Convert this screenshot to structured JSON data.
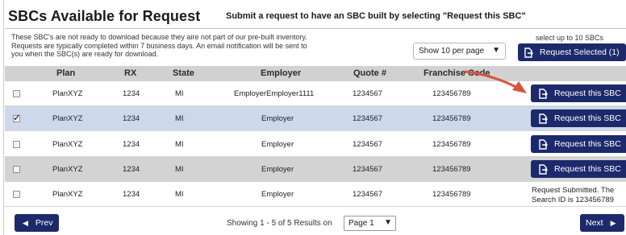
{
  "header": {
    "title": "SBCs Available for Request",
    "subtitle": "Submit a request to have an SBC built by selecting \"Request this SBC\""
  },
  "info": {
    "line1": "These SBC's are not ready to download because they aire not part of our pre-built inventory.",
    "line2": "Requests are typically completed within 7 business days. An email notification will be sent to",
    "line3": "you when the SBC(s) are ready for download."
  },
  "per_page": {
    "value": "Show 10 per page",
    "caret": "▼"
  },
  "select_hint": "select up to 10 SBCs",
  "request_selected_label": "Request Selected (1)",
  "table": {
    "headers": {
      "plan": "Plan",
      "rx": "RX",
      "state": "State",
      "employer": "Employer",
      "quote": "Quote #",
      "franchise": "Franchise Code"
    },
    "rows": [
      {
        "checked": false,
        "plan": "PlanXYZ",
        "rx": "1234",
        "state": "MI",
        "employer": "EmployerEmployer1111",
        "quote": "1234567",
        "franchise": "123456789",
        "action": "Request this SBC",
        "status_line1": "",
        "status_line2": ""
      },
      {
        "checked": true,
        "plan": "PlanXYZ",
        "rx": "1234",
        "state": "MI",
        "employer": "Employer",
        "quote": "1234567",
        "franchise": "123456789",
        "action": "Request this SBC",
        "status_line1": "",
        "status_line2": ""
      },
      {
        "checked": false,
        "plan": "PlanXYZ",
        "rx": "1234",
        "state": "MI",
        "employer": "Employer",
        "quote": "1234567",
        "franchise": "123456789",
        "action": "Request this SBC",
        "status_line1": "",
        "status_line2": ""
      },
      {
        "checked": false,
        "plan": "PlanXYZ",
        "rx": "1234",
        "state": "MI",
        "employer": "Employer",
        "quote": "1234567",
        "franchise": "123456789",
        "action": "Request this SBC",
        "status_line1": "",
        "status_line2": ""
      },
      {
        "checked": false,
        "plan": "PlanXYZ",
        "rx": "1234",
        "state": "MI",
        "employer": "Employer",
        "quote": "1234567",
        "franchise": "123456789",
        "action": "",
        "status_line1": "Request Submitted. The",
        "status_line2": "Search ID is 123456789"
      }
    ]
  },
  "pagination": {
    "prev_label": "Prev",
    "next_label": "Next",
    "showing": "Showing 1 - 5 of 5  Results on",
    "page_value": "Page 1",
    "caret": "▼"
  },
  "colors": {
    "button": "#1c2a6b",
    "arrow": "#d9543a",
    "header_bg": "#d1d1d1",
    "selected_row": "#cdd8ea"
  }
}
